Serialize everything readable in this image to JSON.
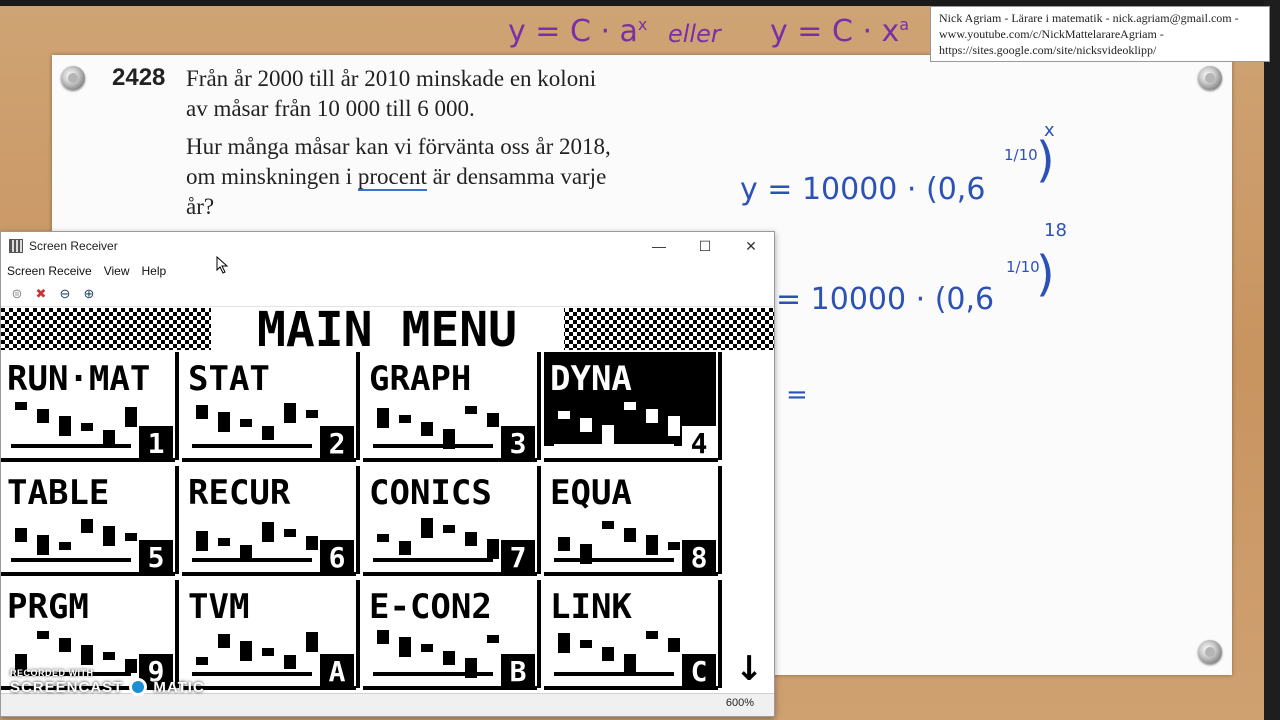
{
  "problem": {
    "number": "2428",
    "line1": "Från år 2000 till år 2010 minskade en koloni av måsar från 10 000 till 6 000.",
    "line2_before": "Hur många måsar kan vi förvänta oss år 2018, om minskningen i ",
    "line2_underlined": "procent",
    "line2_after": " är densamma varje år?"
  },
  "credits": {
    "line1": "Nick Agriam - Lärare i matematik - nick.agriam@gmail.com -",
    "line2": "www.youtube.com/c/NickMattelarareAgriam -",
    "line3": "https://sites.google.com/site/nicksvideoklipp/"
  },
  "handwriting": {
    "formula_top": "y = C · a",
    "exp_x": "x",
    "eller": "eller",
    "formula_top2": "y = C · x",
    "exp_a": "a",
    "eq1": "y = 10000 · (0,6",
    "frac": "1/10",
    "paren": ")",
    "exp1": "x",
    "eq2": "= 10000 · (0,6",
    "exp2": "18",
    "eq3": "="
  },
  "window": {
    "title": "Screen Receiver",
    "menu": [
      "Screen Receive",
      "View",
      "Help"
    ],
    "zoom": "600%"
  },
  "calculator": {
    "header": "MAIN MENU",
    "apps": [
      {
        "name": "RUN·MAT",
        "key": "1"
      },
      {
        "name": "STAT",
        "key": "2"
      },
      {
        "name": "GRAPH",
        "key": "3"
      },
      {
        "name": "DYNA",
        "key": "4"
      },
      {
        "name": "TABLE",
        "key": "5"
      },
      {
        "name": "RECUR",
        "key": "6"
      },
      {
        "name": "CONICS",
        "key": "7"
      },
      {
        "name": "EQUA",
        "key": "8"
      },
      {
        "name": "PRGM",
        "key": "9"
      },
      {
        "name": "TVM",
        "key": "A"
      },
      {
        "name": "E-CON2",
        "key": "B"
      },
      {
        "name": "LINK",
        "key": "C"
      }
    ]
  },
  "watermark": {
    "small": "RECORDED WITH",
    "big": "SCREENCAST",
    "big2": "MATIC"
  },
  "colors": {
    "ink_blue": "#2c52b6",
    "ink_purple": "#7a2fa7",
    "desk": "#c99a66"
  }
}
